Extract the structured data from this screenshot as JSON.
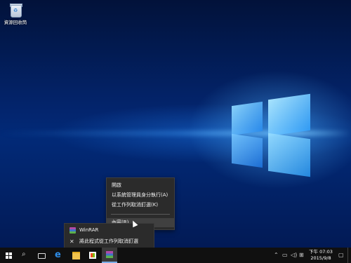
{
  "desktop": {
    "icons": [
      {
        "label": "資源回收筒",
        "icon": "recycle-bin-icon"
      }
    ]
  },
  "context_menu": {
    "items": [
      {
        "label": "開啟"
      },
      {
        "label": "以系統管理員身分執行(A)"
      },
      {
        "label": "從工作列取消釘選(K)"
      },
      {
        "label": "內容(R)",
        "highlighted": true
      }
    ]
  },
  "jump_list": {
    "items": [
      {
        "label": "WinRAR",
        "icon": "winrar-icon"
      },
      {
        "label": "將此程式從工作列取消釘選",
        "icon": "unpin-icon"
      }
    ]
  },
  "taskbar": {
    "buttons": [
      "start-icon",
      "search-icon",
      "task-view-icon",
      "edge-icon",
      "file-explorer-icon",
      "store-icon",
      "winrar-icon"
    ],
    "clock": {
      "time": "下午 07:03",
      "date": "2015/9/8"
    },
    "tray_icons": [
      "chevron-up-icon",
      "network-icon",
      "volume-icon",
      "ime-icon",
      "notification-icon"
    ]
  },
  "colors": {
    "taskbar_bg": "#101010",
    "menu_bg": "#2b2b2b",
    "accent": "#7aaee8"
  }
}
